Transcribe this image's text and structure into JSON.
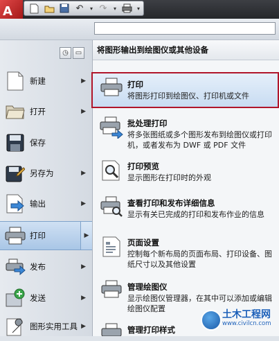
{
  "app": {
    "logo_letter": "A"
  },
  "quick_access": {
    "icons": [
      "new-file-icon",
      "open-folder-icon",
      "save-icon",
      "undo-icon",
      "redo-icon",
      "print-icon"
    ]
  },
  "search": {
    "placeholder": ""
  },
  "left_menu": {
    "items": [
      {
        "id": "new",
        "label": "新建",
        "arrow": "▶"
      },
      {
        "id": "open",
        "label": "打开",
        "arrow": "▶"
      },
      {
        "id": "save",
        "label": "保存",
        "arrow": ""
      },
      {
        "id": "saveas",
        "label": "另存为",
        "arrow": "▶"
      },
      {
        "id": "export",
        "label": "输出",
        "arrow": "▶"
      },
      {
        "id": "print",
        "label": "打印",
        "arrow": "▶"
      },
      {
        "id": "publish",
        "label": "发布",
        "arrow": "▶"
      },
      {
        "id": "send",
        "label": "发送",
        "arrow": "▶"
      },
      {
        "id": "utilities",
        "label": "图形实用工具",
        "arrow": "▶"
      }
    ],
    "active": "print"
  },
  "right_panel": {
    "header": "将图形输出到绘图仪或其他设备",
    "items": [
      {
        "title": "打印",
        "desc": "将图形打印到绘图仪、打印机或文件",
        "icon": "printer-icon",
        "selected": true
      },
      {
        "title": "批处理打印",
        "desc": "将多张图纸或多个图形发布到绘图仪或打印机，或者发布为 DWF 或 PDF 文件",
        "icon": "batch-print-icon"
      },
      {
        "title": "打印预览",
        "desc": "显示图形在打印时的外观",
        "icon": "print-preview-icon"
      },
      {
        "title": "查看打印和发布详细信息",
        "desc": "显示有关已完成的打印和发布作业的信息",
        "icon": "print-details-icon"
      },
      {
        "title": "页面设置",
        "desc": "控制每个新布局的页面布局、打印设备、图纸尺寸以及其他设置",
        "icon": "page-setup-icon"
      },
      {
        "title": "管理绘图仪",
        "desc": "显示绘图仪管理器，在其中可以添加或编辑绘图仪配置",
        "icon": "plotter-manager-icon"
      },
      {
        "title": "管理打印样式",
        "desc": "",
        "icon": "plot-style-icon"
      }
    ]
  },
  "watermark": {
    "main": "土木工程网",
    "url": "www.civilcn.com"
  },
  "colors": {
    "accent": "#b0152a",
    "highlight": "#c8dcf2"
  }
}
